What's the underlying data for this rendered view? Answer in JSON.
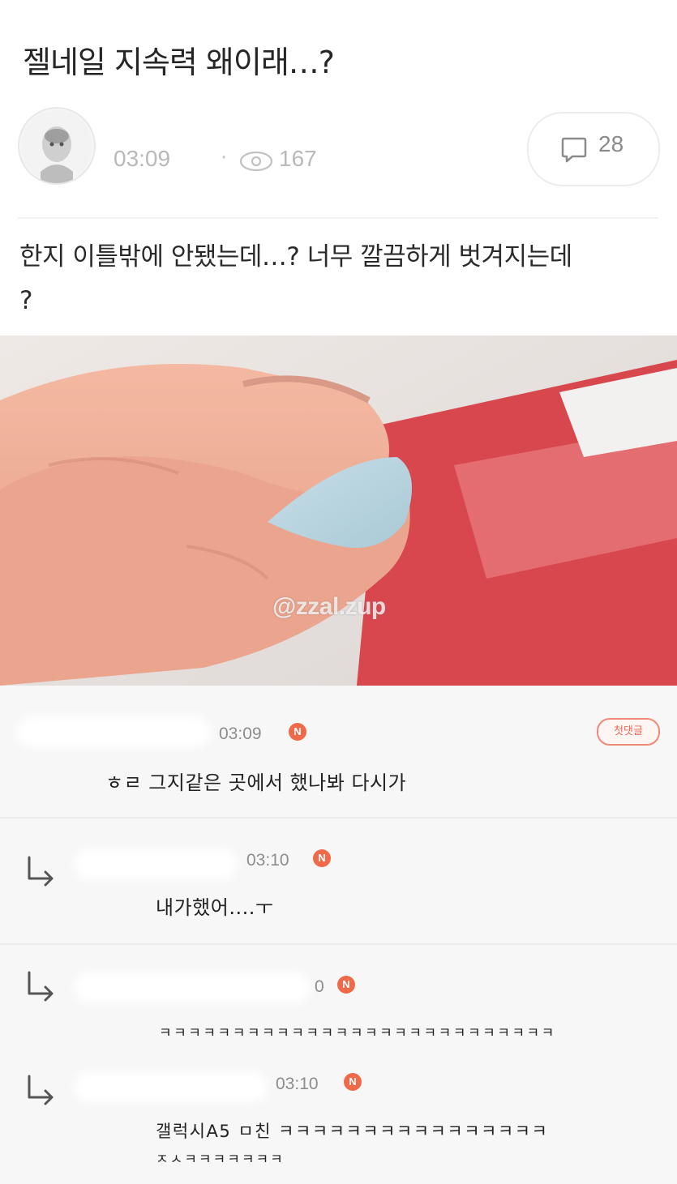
{
  "post": {
    "title": "젤네일 지속력 왜이래…?",
    "time": "03:09",
    "separator": "·",
    "views": "167",
    "comment_count": "28",
    "body_line1": "한지 이틀밖에 안됐는데…? 너무 깔끔하게 벗겨지는데",
    "body_line2": "?"
  },
  "photo": {
    "watermark": "@zzal.zup"
  },
  "comments": [
    {
      "time": "03:09",
      "badge": "N",
      "tag": "첫댓글",
      "text": "ㅎㄹ 그지같은 곳에서 했나봐 다시가"
    },
    {
      "time": "03:10",
      "badge": "N",
      "text": "내가했어....ㅜ"
    },
    {
      "time": "0",
      "badge": "N",
      "text": "ㅋㅋㅋㅋㅋㅋㅋㅋㅋㅋㅋㅋㅋㅋㅋㅋㅋㅋㅋㅋㅋㅋㅋㅋㅋㅋㅋ"
    },
    {
      "time": "03:10",
      "badge": "N",
      "text_line1": "갤럭시A5 ㅁ친 ㅋㅋㅋㅋㅋㅋㅋㅋㅋㅋㅋㅋㅋㅋㅋㅋ",
      "text_line2": "ㅈㅅㅋㅋㅋㅋㅋㅋㅋ"
    }
  ],
  "colors": {
    "badge": "#f06a4a",
    "muted": "#b9b9b9"
  }
}
